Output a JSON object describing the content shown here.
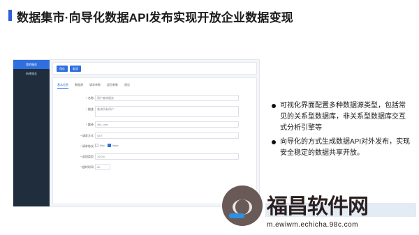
{
  "slide": {
    "title": "数据集市·向导化数据API发布实现开放企业数据变现",
    "accent_color": "#2f5fd7"
  },
  "app": {
    "sidebar": {
      "items": [
        {
          "label": "我的服务",
          "active": true
        },
        {
          "label": "新建服务",
          "active": false
        }
      ]
    },
    "toolbar": {
      "buttons": [
        "保存",
        "取消"
      ]
    },
    "tabs": [
      "基本信息",
      "数据源",
      "请求参数",
      "返回参数",
      "测试"
    ],
    "form": {
      "name": {
        "label": "* 名称:",
        "value": "用户查询服务"
      },
      "desc": {
        "label": "* 描述:",
        "value": "查询所有用户"
      },
      "path": {
        "label": "* 路径:",
        "value": "/list_user"
      },
      "method": {
        "label": "* 请求方式:",
        "value": "GET"
      },
      "protocol": {
        "label": "* 请求协议:",
        "options": [
          {
            "label": "http",
            "checked": false
          },
          {
            "label": "https",
            "checked": true
          }
        ]
      },
      "format": {
        "label": "* 返回类型:",
        "value": "JSON"
      },
      "timeout": {
        "label": "* 超时时间:",
        "value": "60"
      }
    }
  },
  "bullets": [
    "可视化界面配置多种数据源类型，包括常见的关系型数据库，非关系型数据库交互式分析引擎等",
    "向导化的方式生成数据API对外发布，实现安全稳定的数据共享开放。"
  ],
  "watermark": {
    "text": "福昌软件网",
    "url": "m.ewiwm.echicha.98c.com",
    "icon": "leaf-logo-icon"
  }
}
